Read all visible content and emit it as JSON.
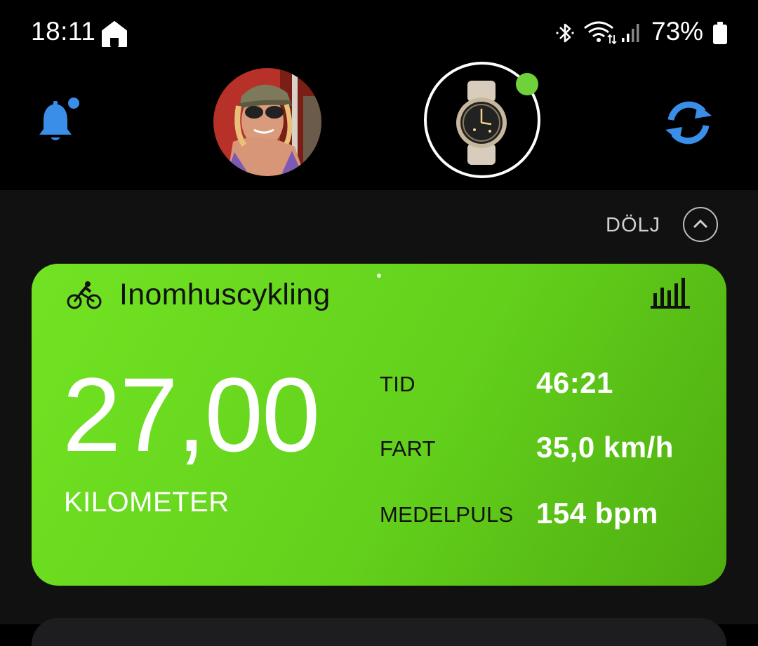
{
  "status_bar": {
    "time": "18:11",
    "battery": "73%",
    "icons": [
      "home-icon",
      "bluetooth-icon",
      "wifi-icon",
      "signal-icon",
      "battery-icon"
    ]
  },
  "header": {
    "icons": [
      "bell-icon",
      "avatar",
      "watch-device",
      "sync-icon"
    ],
    "accent_color": "#3b8ee8",
    "device_status_color": "#6fd23a"
  },
  "collapse": {
    "label": "DÖLJ"
  },
  "activity": {
    "title": "Inomhuscykling",
    "distance_value": "27,00",
    "distance_unit": "KILOMETER",
    "card_color": "#66d81e",
    "stats": [
      {
        "label": "TID",
        "value": "46:21"
      },
      {
        "label": "FART",
        "value": "35,0 km/h"
      },
      {
        "label": "MEDELPULS",
        "value": "154 bpm"
      }
    ]
  }
}
